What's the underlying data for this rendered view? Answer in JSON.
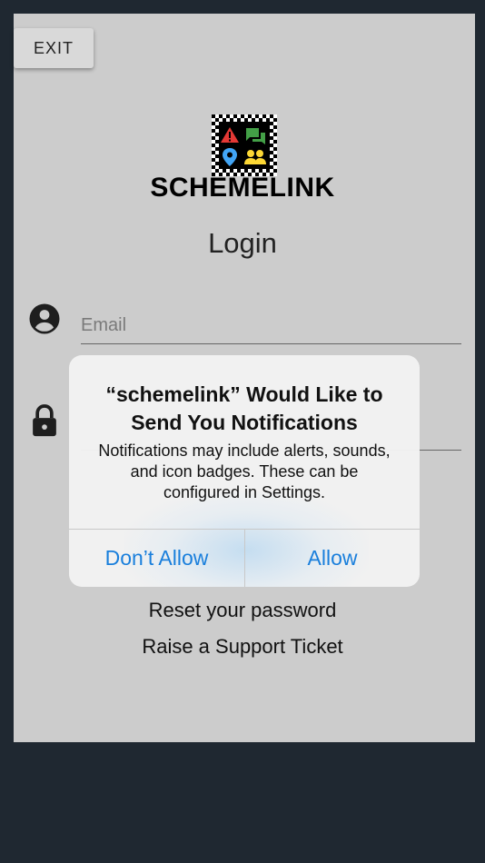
{
  "exit_button": {
    "label": "EXIT"
  },
  "brand": {
    "name": "SCHEMELINK"
  },
  "page_title": "Login",
  "email": {
    "placeholder": "Email",
    "value": ""
  },
  "password": {
    "placeholder": "",
    "value": ""
  },
  "links": {
    "reset_password": "Reset your password",
    "support_ticket": "Raise a Support Ticket"
  },
  "dialog": {
    "title": "“schemelink” Would Like to Send You Notifications",
    "message": "Notifications may include alerts, sounds, and icon badges. These can be configured in Settings.",
    "deny_label": "Don’t Allow",
    "allow_label": "Allow"
  },
  "icons": {
    "logo": [
      "warning-icon",
      "chat-icon",
      "location-pin-icon",
      "people-icon"
    ],
    "email_field": "account-circle-icon",
    "password_field": "lock-icon"
  },
  "colors": {
    "background": "#1f2831",
    "page": "#cccccc",
    "accent_blue": "#1a7fdc",
    "logo_red": "#e53935",
    "logo_green": "#43a047",
    "logo_blue": "#42a5f5",
    "logo_yellow": "#fdd835"
  }
}
